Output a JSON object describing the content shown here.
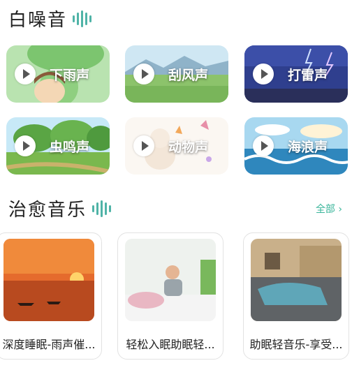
{
  "white_noise": {
    "title": "白噪音",
    "tiles": [
      {
        "label": "下雨声",
        "icon": "play-icon"
      },
      {
        "label": "刮风声",
        "icon": "play-icon"
      },
      {
        "label": "打雷声",
        "icon": "play-icon"
      },
      {
        "label": "虫鸣声",
        "icon": "play-icon"
      },
      {
        "label": "动物声",
        "icon": "play-icon"
      },
      {
        "label": "海浪声",
        "icon": "play-icon"
      }
    ]
  },
  "healing_music": {
    "title": "治愈音乐",
    "see_all": "全部 ›",
    "cards": [
      {
        "title": "深度睡眠-雨声催..."
      },
      {
        "title": "轻松入眠助眠轻..."
      },
      {
        "title": "助眠轻音乐-享受..."
      }
    ]
  },
  "colors": {
    "accent": "#39b59a",
    "bars": "#4fb3a7"
  }
}
